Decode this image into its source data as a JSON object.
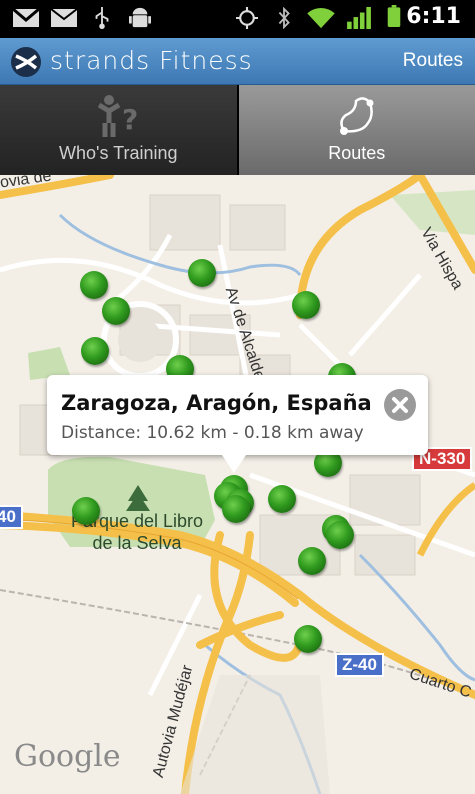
{
  "status_bar": {
    "time": "6:11",
    "icons": [
      "gmail-icon",
      "email-icon",
      "usb-icon",
      "android-debug-icon",
      "gps-icon",
      "bluetooth-icon",
      "wifi-icon",
      "signal-icon",
      "battery-icon"
    ]
  },
  "header": {
    "app_name": "strands Fitness",
    "right_label": "Routes"
  },
  "tabs": [
    {
      "label": "Who's Training",
      "icon": "who-training-icon",
      "selected": false
    },
    {
      "label": "Routes",
      "icon": "routes-icon",
      "selected": true
    }
  ],
  "map": {
    "park_label": "Parque del Libro\nde la Selva",
    "road_labels": {
      "avenida": "Av de Alcalde Gómez",
      "via_hispanidad": "Via Hispa",
      "autovia": "Autovia Mudéjar",
      "cuarto": "Cuarto C",
      "top_left": "ovia de"
    },
    "shields": {
      "n330": "N-330",
      "z40": "Z-40",
      "left": "40"
    },
    "attribution": "Google",
    "marker_count": 20
  },
  "info_bubble": {
    "title": "Zaragoza, Aragón, España",
    "subtitle": "Distance: 10.62 km - 0.18 km away"
  },
  "colors": {
    "header_blue": "#4a86c2",
    "marker_green": "#2f9a1e",
    "highway_yellow": "#f7c84a",
    "shield_red": "#d63a3a",
    "shield_blue": "#4a6fc9"
  }
}
